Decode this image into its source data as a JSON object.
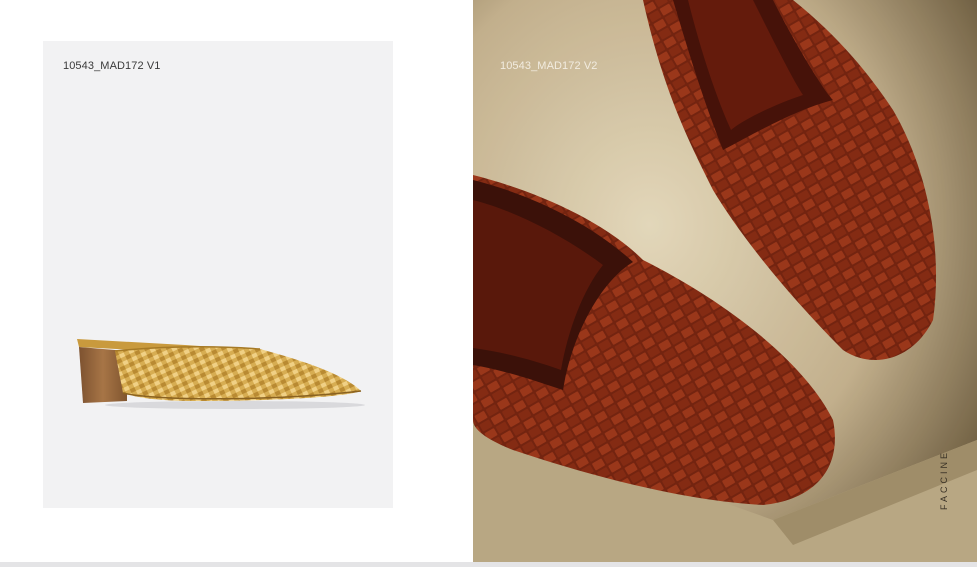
{
  "products": [
    {
      "code": "10543_MAD172 V1",
      "image": "gold-woven-mule-icon"
    },
    {
      "code": "10543_MAD172 V2",
      "image": "brown-woven-mules-photo-icon"
    }
  ],
  "brand": "FACCINE",
  "colors": {
    "card_bg": "#f2f2f3",
    "gold": "#d4a94a",
    "leather": "#8e2e14",
    "wood": "#9c6b3f",
    "backdrop": "#d9cbac"
  }
}
